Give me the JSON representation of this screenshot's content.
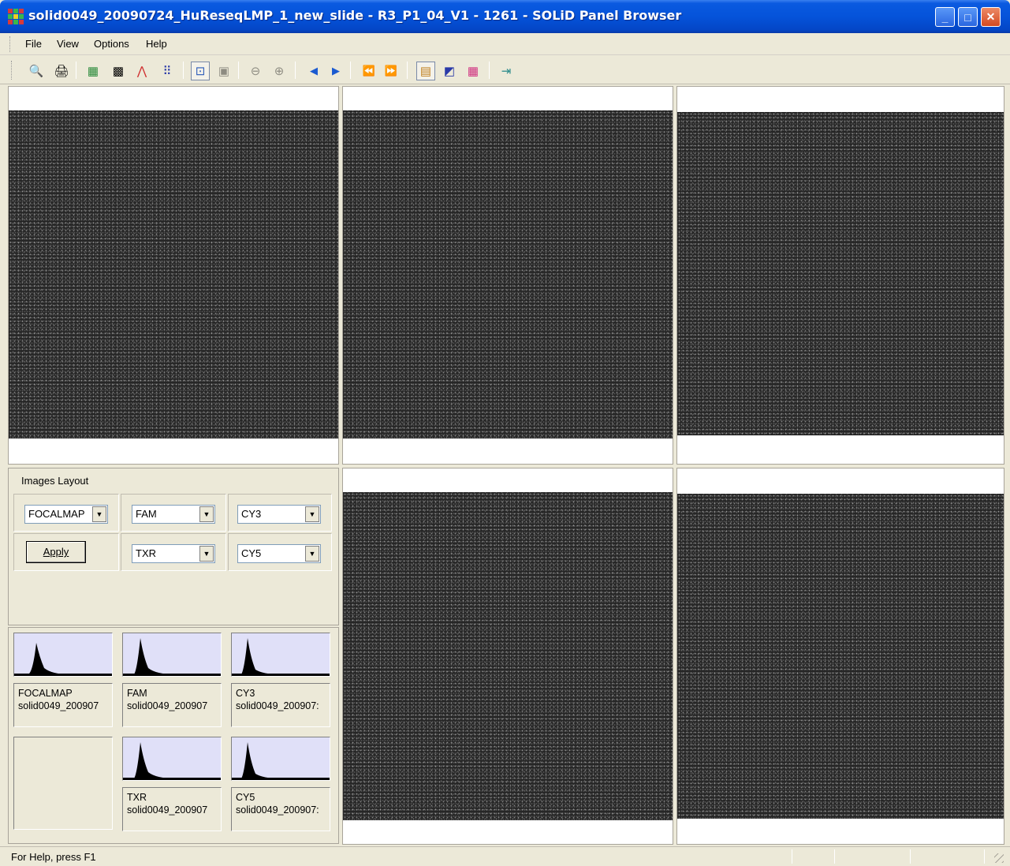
{
  "window": {
    "title": "solid0049_20090724_HuReseqLMP_1_new_slide - R3_P1_04_V1 - 1261 - SOLiD Panel Browser",
    "min_glyph": "_",
    "max_glyph": "□",
    "close_glyph": "✕"
  },
  "menu": [
    "File",
    "View",
    "Options",
    "Help"
  ],
  "toolbar": {
    "icons": {
      "print_preview": "print-preview-icon",
      "print": "print-icon",
      "color_map": "color-map-icon",
      "bw_map": "bw-map-icon",
      "histogram": "histogram-icon",
      "grid": "grid-dots-icon",
      "fit": "fit-to-window-icon",
      "actual": "actual-size-icon",
      "zoom_out": "zoom-out-icon",
      "zoom_in": "zoom-in-icon",
      "prev": "previous-icon",
      "next": "next-icon",
      "first": "first-icon",
      "last": "last-icon",
      "layout": "layout-icon",
      "overlay": "overlay-icon",
      "palette": "palette-icon",
      "exit": "exit-icon"
    },
    "glyphs": {
      "print_preview": "🔍",
      "print": "🖨",
      "color_map": "▦",
      "bw_map": "▩",
      "histogram": "⋀",
      "grid": "⠿",
      "fit": "⊡",
      "actual": "▣",
      "zoom_out": "⊖",
      "zoom_in": "⊕",
      "prev": "◀",
      "next": "▶",
      "first": "⏪",
      "last": "⏩",
      "layout": "▤",
      "overlay": "◩",
      "palette": "▦",
      "exit": "⇥"
    }
  },
  "layout_panel": {
    "title": "Images Layout",
    "combos": [
      "FOCALMAP",
      "FAM",
      "CY3",
      "TXR",
      "CY5"
    ],
    "combo_arrow": "▼",
    "apply_label": "Apply"
  },
  "thumbnails": [
    {
      "channel": "FOCALMAP",
      "file": "solid0049_200907"
    },
    {
      "channel": "FAM",
      "file": "solid0049_200907"
    },
    {
      "channel": "CY3",
      "file": "solid0049_200907:"
    },
    {
      "channel": "TXR",
      "file": "solid0049_200907"
    },
    {
      "channel": "CY5",
      "file": "solid0049_200907:"
    }
  ],
  "status": {
    "text": "For Help, press F1"
  }
}
